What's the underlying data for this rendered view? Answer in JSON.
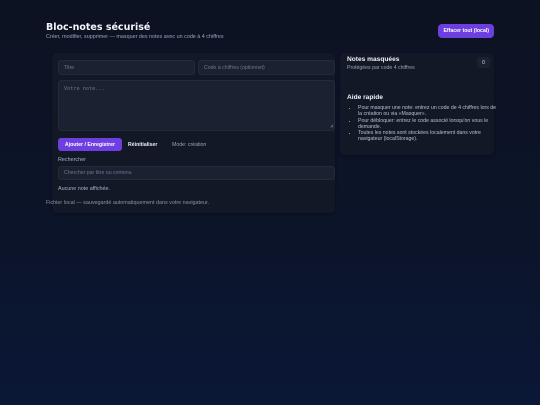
{
  "header": {
    "title": "Bloc-notes sécurisé",
    "subtitle": "Créer, modifier, supprimer — masquer des notes avec un code à 4 chiffres",
    "clear_all_label": "Effacer tout (local)"
  },
  "editor": {
    "title_placeholder": "Titre",
    "code_placeholder": "Code à chiffres (optionnel)",
    "note_placeholder": "Votre note...",
    "add_label": "Ajouter / Enregistrer",
    "reset_label": "Réinitialiser",
    "mode_text": "Mode: création",
    "search_label": "Rechercher",
    "search_placeholder": "Chercher par titre ou contenu",
    "empty_text": "Aucune note affichée."
  },
  "footer": {
    "text": "Fichier local — sauvegardé automatiquement dans votre navigateur."
  },
  "hidden_notes": {
    "title": "Notes masquées",
    "subtitle": "Protégées par code 4 chiffres",
    "count": "0"
  },
  "help": {
    "title": "Aide rapide",
    "items": [
      "Pour masquer une note: entrez un code de 4 chiffres lors de la création ou via «Masquer».",
      "Pour débloquer: entrez le code associé lorsqu'on vous le demande.",
      "Toutes les notes sont stockées localement dans votre navigateur (localStorage)."
    ]
  },
  "icons": {
    "resize": "resize-handle-icon"
  },
  "colors": {
    "accent": "#6d3fe0",
    "card": "#121826",
    "field": "#1b2130"
  }
}
